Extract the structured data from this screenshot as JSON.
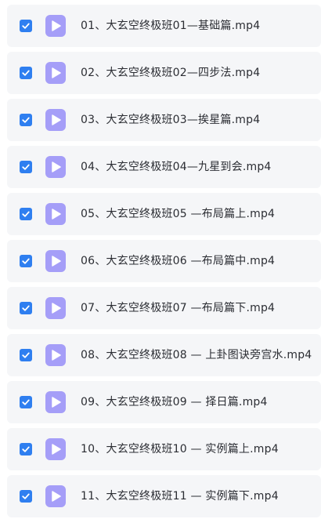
{
  "files": [
    {
      "name": "01、大玄空终极班01—基础篇.mp4",
      "checked": true
    },
    {
      "name": "02、大玄空终极班02—四步法.mp4",
      "checked": true
    },
    {
      "name": "03、大玄空终极班03—挨星篇.mp4",
      "checked": true
    },
    {
      "name": "04、大玄空终极班04—九星到会.mp4",
      "checked": true
    },
    {
      "name": "05、大玄空终极班05 —布局篇上.mp4",
      "checked": true
    },
    {
      "name": "06、大玄空终极班06 —布局篇中.mp4",
      "checked": true
    },
    {
      "name": "07、大玄空终极班07 —布局篇下.mp4",
      "checked": true
    },
    {
      "name": "08、大玄空终极班08 — 上卦图诀旁宫水.mp4",
      "checked": true
    },
    {
      "name": "09、大玄空终极班09 — 择日篇.mp4",
      "checked": true
    },
    {
      "name": "10、大玄空终极班10 — 实例篇上.mp4",
      "checked": true
    },
    {
      "name": "11、大玄空终极班11 — 实例篇下.mp4",
      "checked": true
    }
  ],
  "icons": {
    "checkbox": "check-icon",
    "file": "video-play-icon"
  },
  "colors": {
    "checkbox": "#2f7ff0",
    "file_icon": "#a59ef8",
    "row_bg": "#f5f6f8",
    "text": "#2b2d33"
  }
}
